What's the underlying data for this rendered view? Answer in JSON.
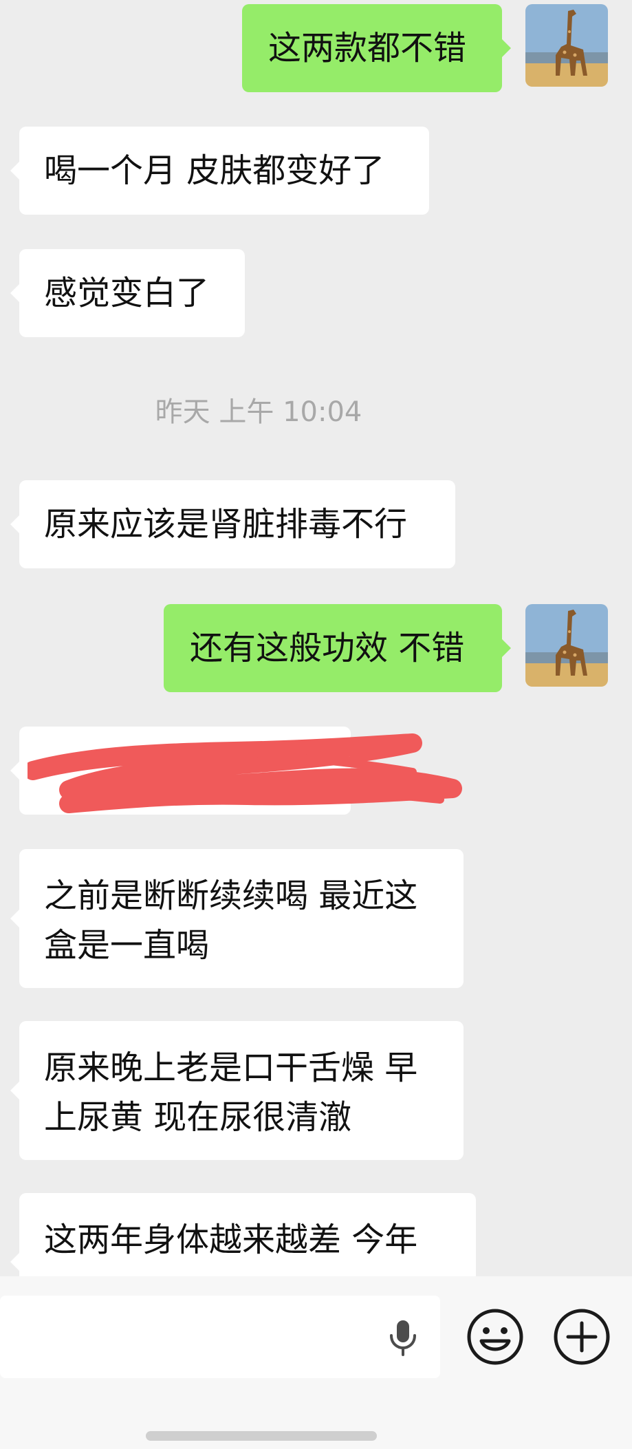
{
  "conversation": {
    "messages": [
      {
        "side": "out",
        "text": "这两款都不错"
      },
      {
        "side": "in",
        "text": "喝一个月 皮肤都变好了"
      },
      {
        "side": "in",
        "text": "感觉变白了"
      },
      {
        "side": "in",
        "text": "原来应该是肾脏排毒不行"
      },
      {
        "side": "out",
        "text": "还有这般功效 不错"
      },
      {
        "side": "in",
        "text": "",
        "redacted": true
      },
      {
        "side": "in",
        "text": "之前是断断续续喝 最近这盒是一直喝"
      },
      {
        "side": "in",
        "text": "原来晚上老是口干舌燥 早上尿黄 现在尿很清澈"
      },
      {
        "side": "in",
        "text": "这两年身体越来越差 今年"
      }
    ],
    "timestamp": "昨天 上午 10:04"
  },
  "colors": {
    "background": "#ededed",
    "outgoing_bubble": "#95ec69",
    "incoming_bubble": "#ffffff",
    "redaction": "#f05a5a"
  },
  "icons": {
    "avatar": "giraffe-avatar",
    "voice": "mic-icon",
    "emoji": "emoji-icon",
    "more": "plus-icon"
  }
}
